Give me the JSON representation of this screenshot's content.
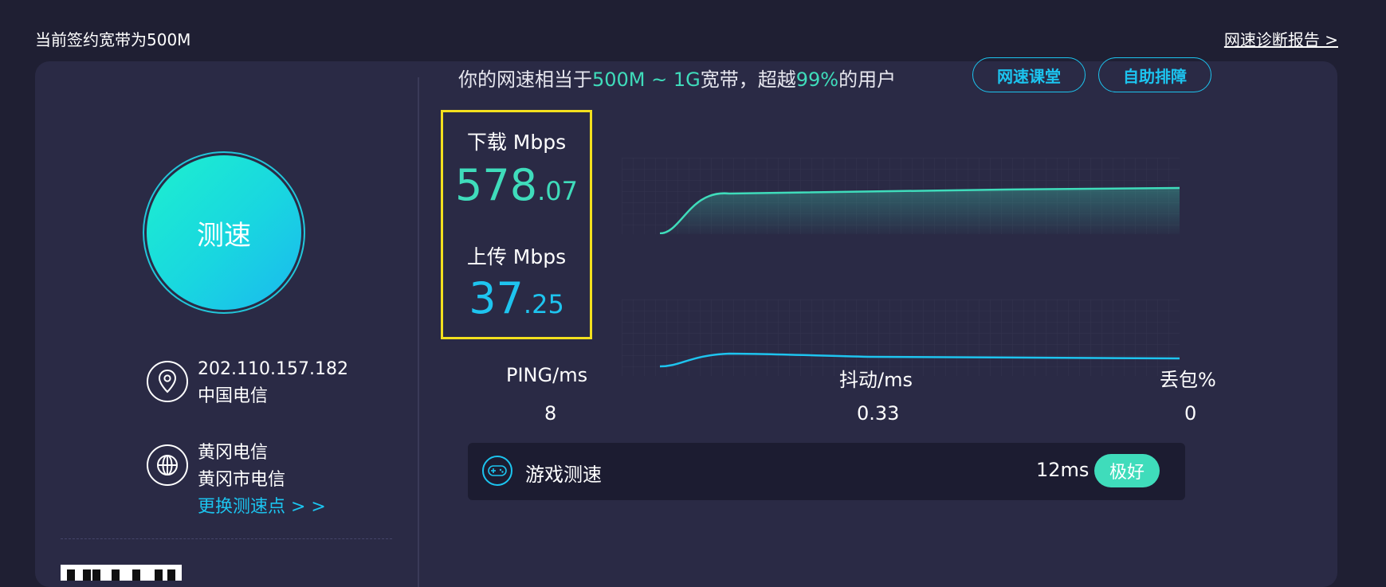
{
  "header": {
    "plan_text": "当前签约宽带为500M",
    "report_link": "网速诊断报告 >"
  },
  "left": {
    "start_button": "测速",
    "ip": "202.110.157.182",
    "isp": "中国电信",
    "server_name": "黄冈电信",
    "server_city": "黄冈市电信",
    "change_server": "更换测速点 > >"
  },
  "summary": {
    "prefix": "你的网速相当于",
    "range": "500M ~ 1G",
    "mid": "宽带，超越",
    "percent": "99%",
    "suffix": "的用户"
  },
  "buttons": {
    "course": "网速课堂",
    "troubleshoot": "自助排障"
  },
  "download": {
    "label": "下载 Mbps",
    "int": "578",
    "dec": ".07",
    "color": "#3fdcbb"
  },
  "upload": {
    "label": "上传 Mbps",
    "int": "37",
    "dec": ".25",
    "color": "#1ec4ef"
  },
  "stats": {
    "ping_label": "PING/ms",
    "ping_value": "8",
    "jitter_label": "抖动/ms",
    "jitter_value": "0.33",
    "loss_label": "丢包%",
    "loss_value": "0"
  },
  "game": {
    "label": "游戏测速",
    "latency": "12ms",
    "rating": "极好"
  },
  "icons": {
    "location": "location-pin-icon",
    "server": "globe-icon",
    "game": "gamepad-icon"
  }
}
